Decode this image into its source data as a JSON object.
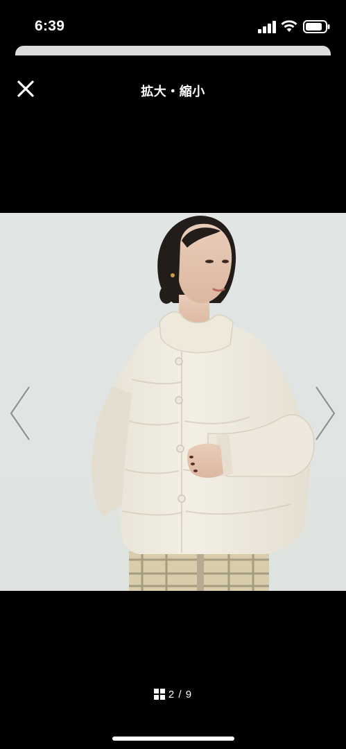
{
  "status_bar": {
    "time": "6:39",
    "icons": [
      "signal-icon",
      "wifi-icon",
      "battery-icon"
    ]
  },
  "header": {
    "title": "拡大・縮小",
    "close_icon": "close-icon"
  },
  "viewer": {
    "current_page": 2,
    "total_pages": 9,
    "counter_text": "2 / 9",
    "prev_icon": "chevron-left-icon",
    "next_icon": "chevron-right-icon",
    "grid_icon": "grid-icon"
  },
  "colors": {
    "background": "#000000",
    "photo_backdrop": "#e0e5e3",
    "jacket": "#efeadf"
  }
}
